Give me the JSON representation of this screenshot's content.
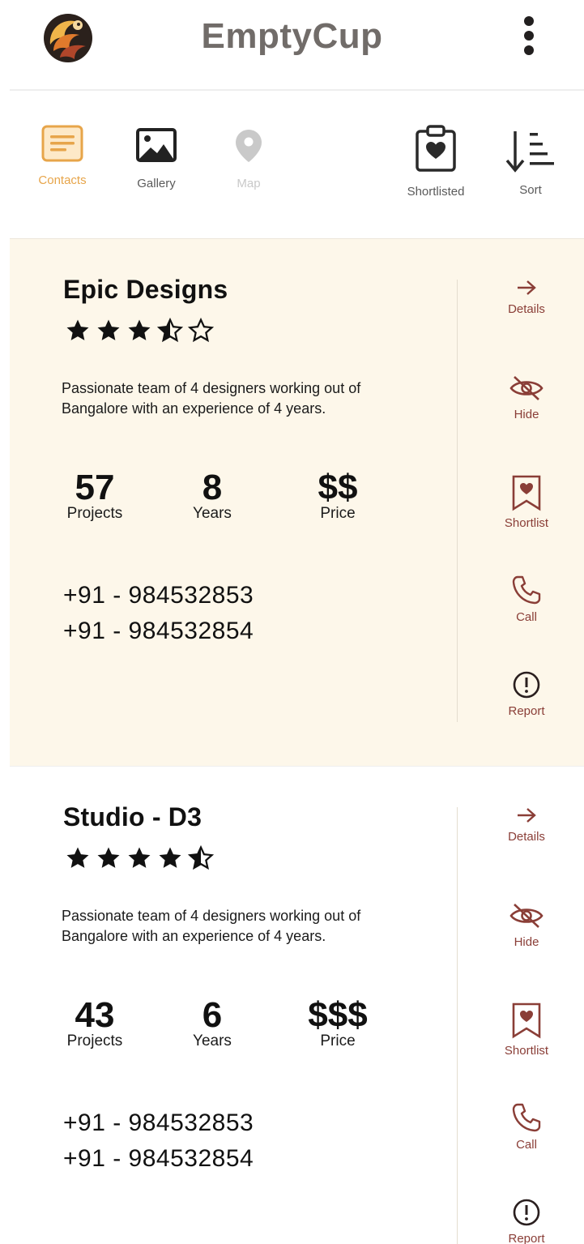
{
  "app": {
    "title": "EmptyCup",
    "colors": {
      "accent": "#e7a54a",
      "action": "#8a3e37",
      "card_bg": "#fdf7ea",
      "title": "#716c69"
    }
  },
  "tabs": [
    {
      "label": "Contacts",
      "icon": "contacts-icon",
      "active": true
    },
    {
      "label": "Gallery",
      "icon": "image-icon",
      "active": false
    },
    {
      "label": "Map",
      "icon": "map-pin-icon",
      "active": false,
      "disabled": true
    },
    {
      "label": "Shortlisted",
      "icon": "clipboard-heart-icon",
      "active": false
    },
    {
      "label": "Sort",
      "icon": "sort-icon",
      "active": false
    }
  ],
  "actions": {
    "details": "Details",
    "hide": "Hide",
    "shortlist": "Shortlist",
    "call": "Call",
    "report": "Report"
  },
  "cards": [
    {
      "name": "Epic Designs",
      "rating": 3.5,
      "rating_max": 5,
      "description": "Passionate team of 4 designers working out of Bangalore with an experience of 4 years.",
      "projects": "57",
      "projects_label": "Projects",
      "years": "8",
      "years_label": "Years",
      "price": "$$",
      "price_label": "Price",
      "phones": [
        "+91 - 984532853",
        "+91 - 984532854"
      ]
    },
    {
      "name": "Studio - D3",
      "rating": 4.5,
      "rating_max": 5,
      "description": "Passionate team of 4 designers working out of Bangalore with an experience of 4 years.",
      "projects": "43",
      "projects_label": "Projects",
      "years": "6",
      "years_label": "Years",
      "price": "$$$",
      "price_label": "Price",
      "phones": [
        "+91 - 984532853",
        "+91 - 984532854"
      ]
    }
  ]
}
